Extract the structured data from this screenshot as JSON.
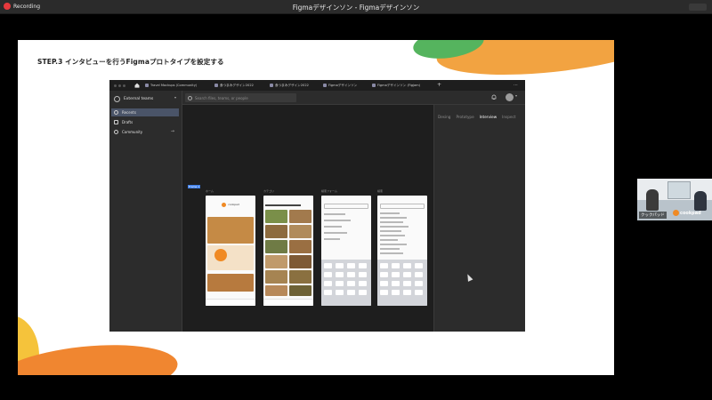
{
  "window": {
    "title": "Figmaデザインソン - Figmaデザインソン",
    "recording_label": "Recording",
    "colors": {
      "record_dot": "#e6393d",
      "titlebar": "#2b2b2b"
    }
  },
  "slide": {
    "title": "STEP.3 インタビューを行うFigmaプロトタイプを設定する",
    "colors": {
      "accent_orange": "#f2a341",
      "accent_green": "#55b45e",
      "accent_yellow": "#f5c33b"
    }
  },
  "figma": {
    "tabs": [
      {
        "label": "Travel Mockups (Community)"
      },
      {
        "label": "食つまみデザイン2022"
      },
      {
        "label": "食つまみデザイン2022"
      },
      {
        "label": "Figmaデザインソン"
      },
      {
        "label": "Figmaデザインソン (Figjam)"
      }
    ],
    "team_name": "External teams",
    "nav": [
      {
        "label": "Recents",
        "icon": "clock-icon",
        "active": true
      },
      {
        "label": "Drafts",
        "icon": "file-icon",
        "active": false
      },
      {
        "label": "Community",
        "icon": "globe-icon",
        "active": false
      }
    ],
    "search_placeholder": "Search files, teams, or people",
    "right_tabs": [
      "Desing",
      "Prototype",
      "Interview",
      "Inspect"
    ],
    "active_right_tab": "Interview",
    "frame_label": "Frame 1",
    "frames": [
      {
        "title": "ホーム",
        "logo": "cookpad"
      },
      {
        "title": "カテゴリ"
      },
      {
        "title": "検索フォーム"
      },
      {
        "title": "検索"
      }
    ]
  },
  "video": {
    "name": "クックパッド",
    "logo_text": "cookpad"
  }
}
